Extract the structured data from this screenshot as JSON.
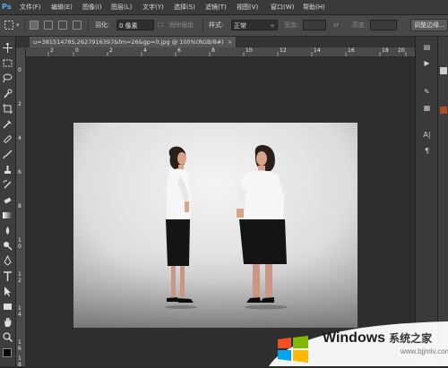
{
  "app": {
    "logo": "Ps"
  },
  "menu": {
    "items": [
      "文件(F)",
      "编辑(E)",
      "图像(I)",
      "图层(L)",
      "文字(Y)",
      "选择(S)",
      "滤镜(T)",
      "视图(V)",
      "窗口(W)",
      "帮助(H)"
    ]
  },
  "options": {
    "feather_label": "羽化:",
    "feather_value": "0 像素",
    "antialias_label": "消除锯齿",
    "style_label": "样式:",
    "style_value": "正常",
    "width_label": "宽度:",
    "height_label": "高度:",
    "refine_edge_label": "调整边缘..."
  },
  "document": {
    "tab_title": "u=381514785,2627916397&fm=26&gp=0.jpg @ 100%(RGB/8#)",
    "close_glyph": "×"
  },
  "rulers": {
    "top": [
      "2",
      "0",
      "2",
      "4",
      "6",
      "8",
      "10",
      "12",
      "14",
      "16",
      "18",
      "20"
    ],
    "left": [
      "0",
      "2",
      "4",
      "6",
      "8",
      "1 0",
      "1 2",
      "1 4",
      "1 6",
      "1 8"
    ]
  },
  "watermark": {
    "brand": "Windows",
    "brand_cn": "系统之家",
    "url": "www.bjjmlv.com"
  },
  "right_panel": {
    "text_icon_label": "A|",
    "para_icon_label": "¶"
  },
  "colors": {
    "accent": "#59a8e8",
    "ui_bg": "#3a3a3a",
    "canvas_bg": "#2e2e2e"
  }
}
